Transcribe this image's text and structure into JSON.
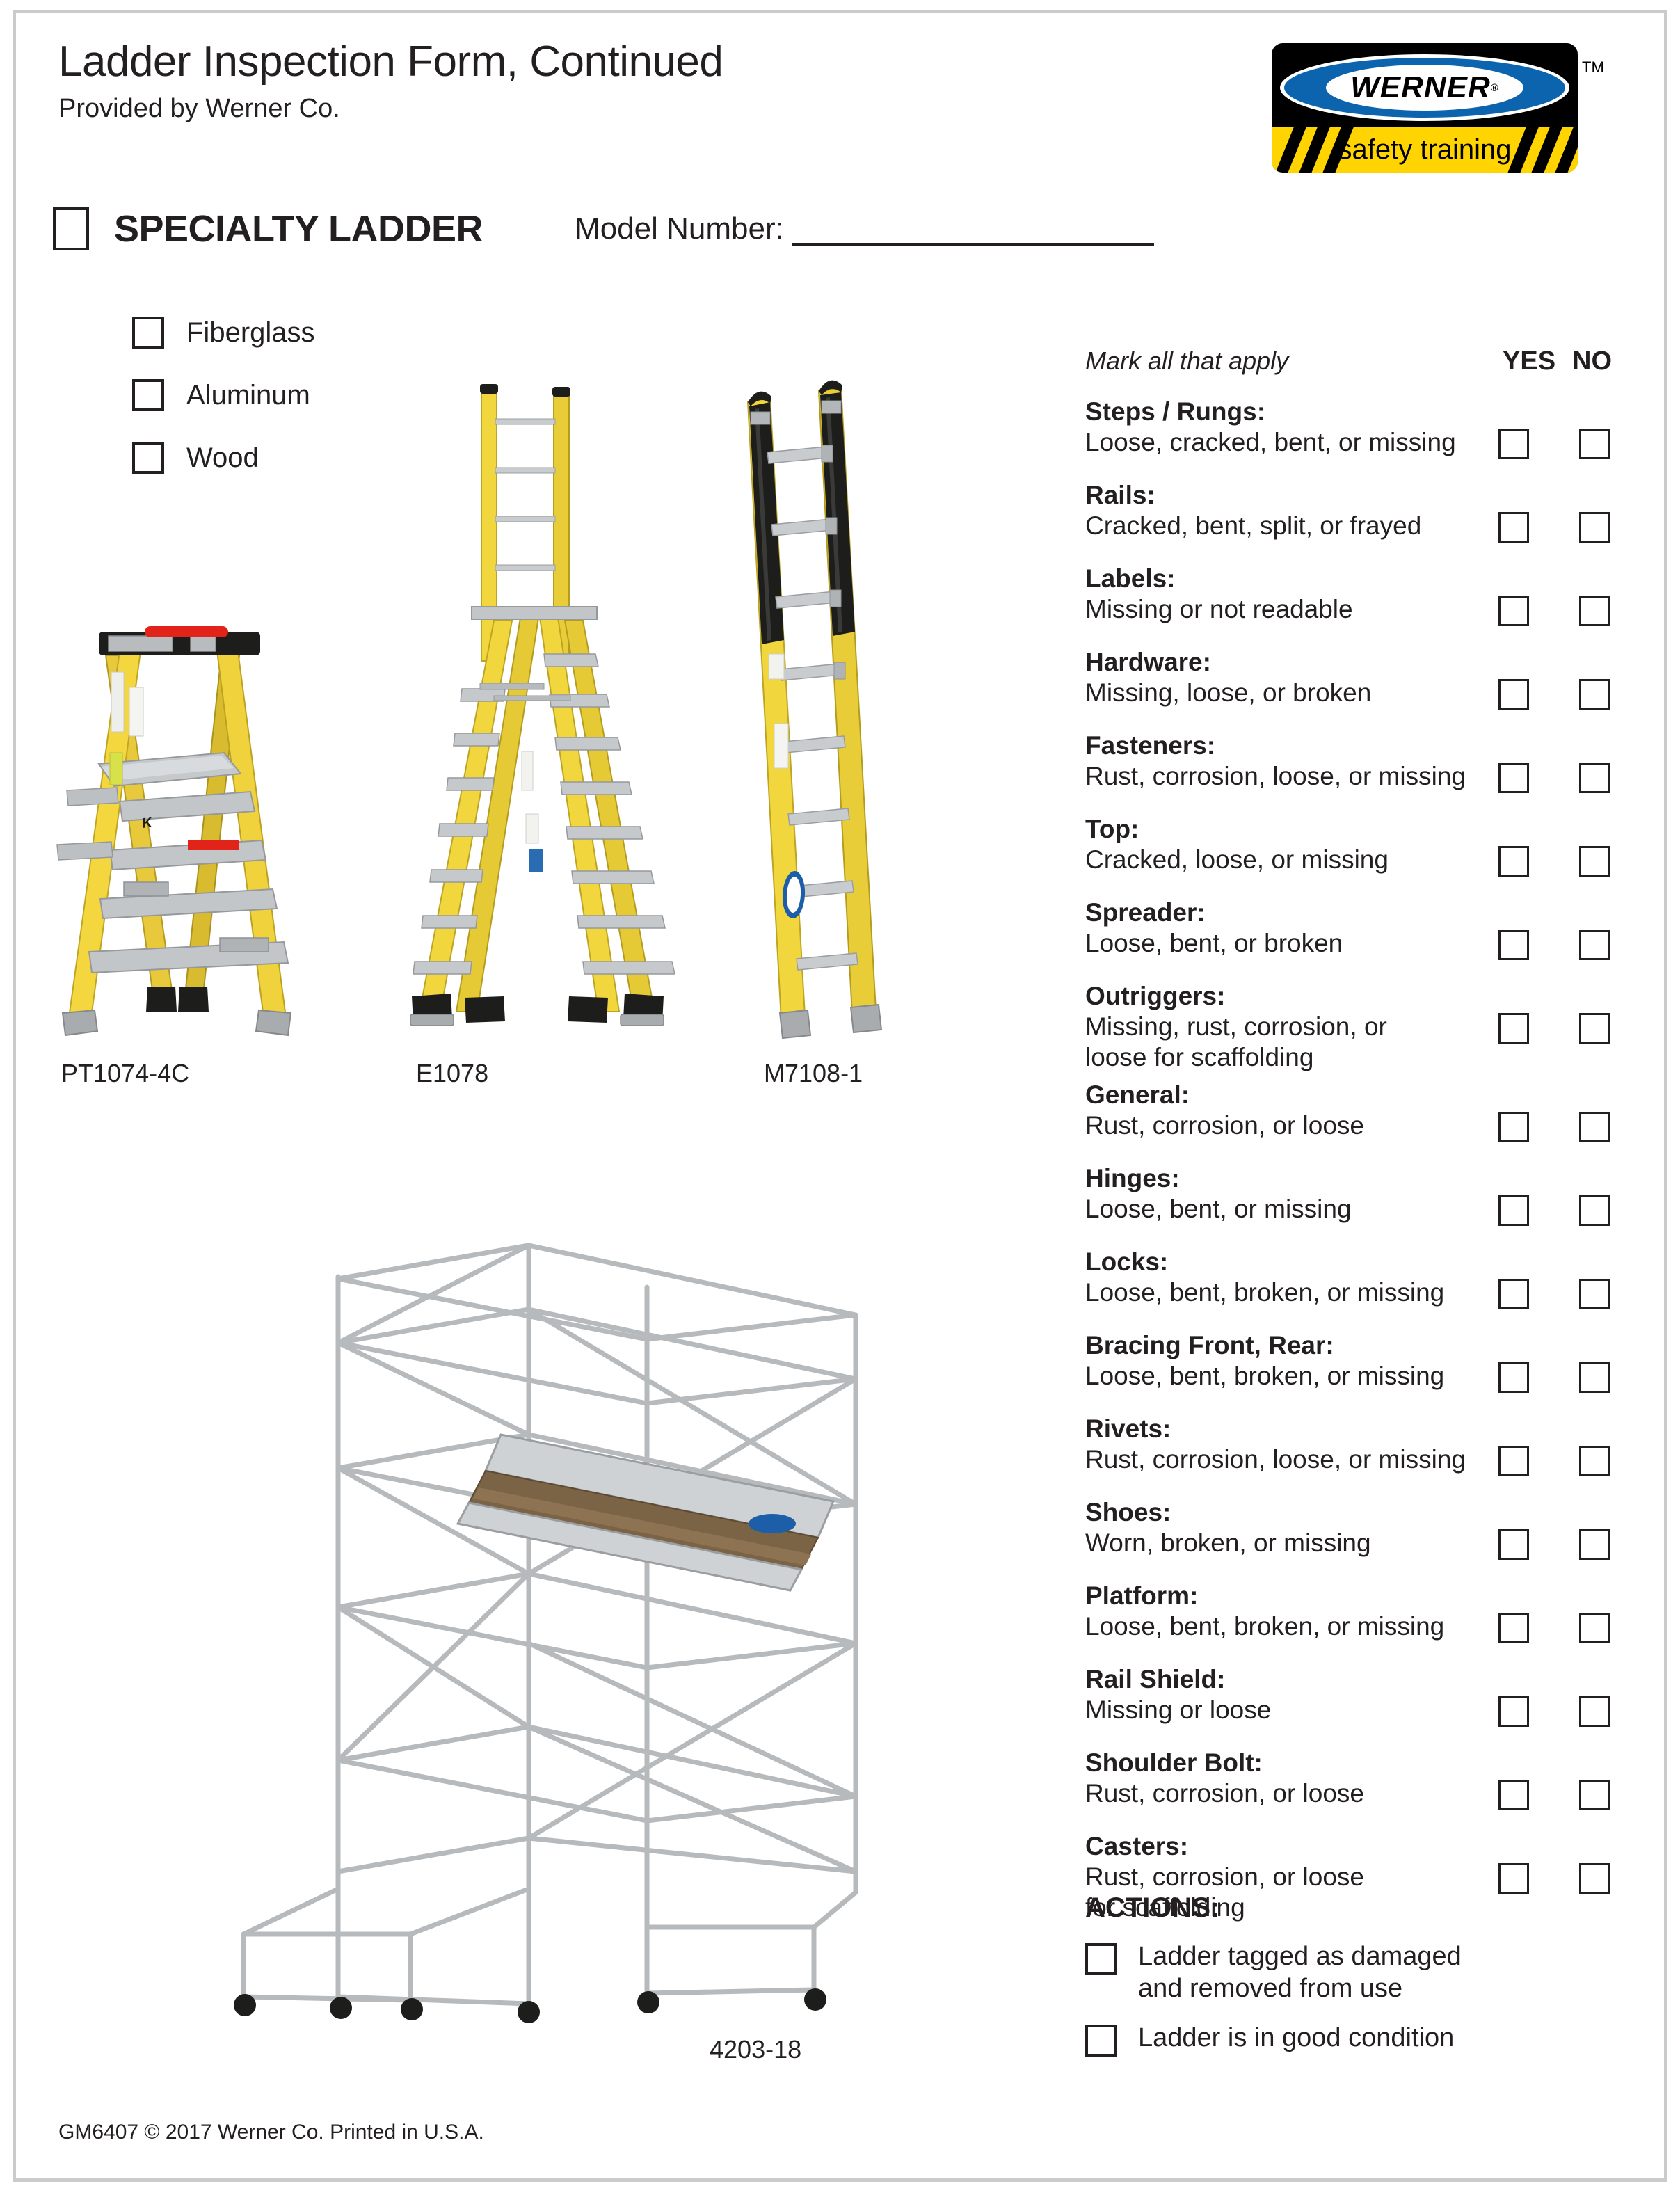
{
  "header": {
    "title": "Ladder Inspection Form, Continued",
    "subtitle": "Provided by Werner Co."
  },
  "logo": {
    "wordmark": "WERNER",
    "registered": "®",
    "tagline": "safety training",
    "trademark": "TM",
    "colors": {
      "black": "#000000",
      "blue": "#0d64ae",
      "yellow": "#ffd400",
      "white": "#ffffff"
    }
  },
  "specialty": {
    "label": "SPECIALTY LADDER",
    "model_label": "Model Number:",
    "model_value": ""
  },
  "materials": [
    {
      "label": "Fiberglass"
    },
    {
      "label": "Aluminum"
    },
    {
      "label": "Wood"
    }
  ],
  "ladders": [
    {
      "caption": "PT1074-4C"
    },
    {
      "caption": "E1078"
    },
    {
      "caption": "M7108-1"
    }
  ],
  "scaffold": {
    "caption": "4203-18"
  },
  "checklist": {
    "instruction": "Mark all that apply",
    "yes_header": "YES",
    "no_header": "NO",
    "items": [
      {
        "term": "Steps / Rungs:",
        "desc": "Loose, cracked, bent, or missing"
      },
      {
        "term": "Rails:",
        "desc": "Cracked, bent, split, or frayed"
      },
      {
        "term": "Labels:",
        "desc": "Missing or not readable"
      },
      {
        "term": "Hardware:",
        "desc": "Missing, loose, or broken"
      },
      {
        "term": "Fasteners:",
        "desc": "Rust, corrosion, loose, or missing"
      },
      {
        "term": "Top:",
        "desc": "Cracked, loose, or missing"
      },
      {
        "term": "Spreader:",
        "desc": "Loose, bent, or broken"
      },
      {
        "term": "Outriggers:",
        "desc": "Missing, rust, corrosion, or\nloose for scaffolding"
      },
      {
        "term": "General:",
        "desc": "Rust, corrosion, or loose"
      },
      {
        "term": "Hinges:",
        "desc": "Loose, bent, or missing"
      },
      {
        "term": "Locks:",
        "desc": "Loose, bent, broken, or missing"
      },
      {
        "term": "Bracing Front, Rear:",
        "desc": "Loose, bent, broken, or missing"
      },
      {
        "term": "Rivets:",
        "desc": "Rust, corrosion, loose, or missing"
      },
      {
        "term": "Shoes:",
        "desc": "Worn, broken, or missing"
      },
      {
        "term": "Platform:",
        "desc": "Loose, bent, broken, or missing"
      },
      {
        "term": "Rail Shield:",
        "desc": "Missing or loose"
      },
      {
        "term": "Shoulder Bolt:",
        "desc": "Rust, corrosion, or loose"
      },
      {
        "term": "Casters:",
        "desc": "Rust, corrosion, or loose\nfor scaffolding"
      }
    ]
  },
  "actions": {
    "title": "ACTIONS:",
    "options": [
      {
        "label": "Ladder tagged as damaged\nand removed from use"
      },
      {
        "label": "Ladder is in good condition"
      }
    ]
  },
  "footer": {
    "text": "GM6407 © 2017 Werner Co. Printed in U.S.A."
  }
}
